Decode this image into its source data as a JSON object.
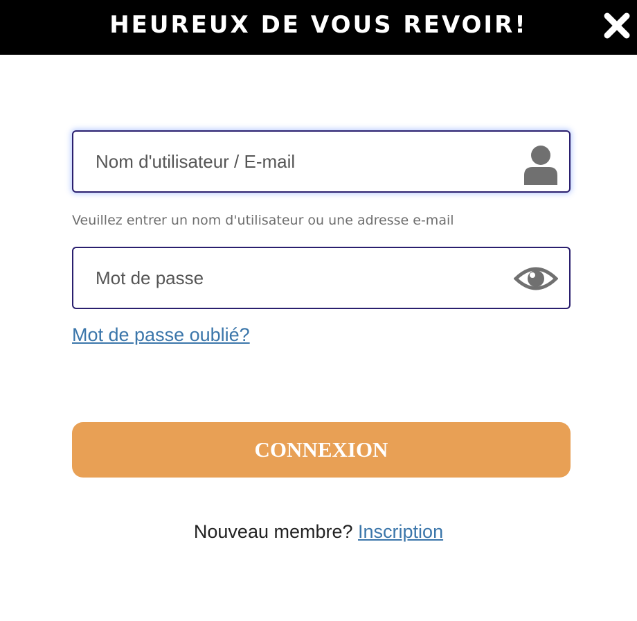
{
  "header": {
    "title": "HEUREUX DE VOUS REVOIR!",
    "close_icon": "close-icon"
  },
  "form": {
    "username": {
      "placeholder": "Nom d'utilisateur / E-mail",
      "value": "",
      "icon": "user-icon",
      "hint": "Veuillez entrer un nom d'utilisateur ou une adresse e-mail"
    },
    "password": {
      "placeholder": "Mot de passe",
      "value": "",
      "icon": "eye-icon"
    },
    "forgot_label": "Mot de passe oublié?",
    "submit_label": "CONNEXION"
  },
  "signup": {
    "prompt": "Nouveau membre?",
    "link_label": "Inscription"
  },
  "colors": {
    "header_bg": "#000000",
    "field_border": "#2a1f6e",
    "link": "#3b76aa",
    "submit_bg": "#e8a055",
    "icon": "#707070"
  }
}
